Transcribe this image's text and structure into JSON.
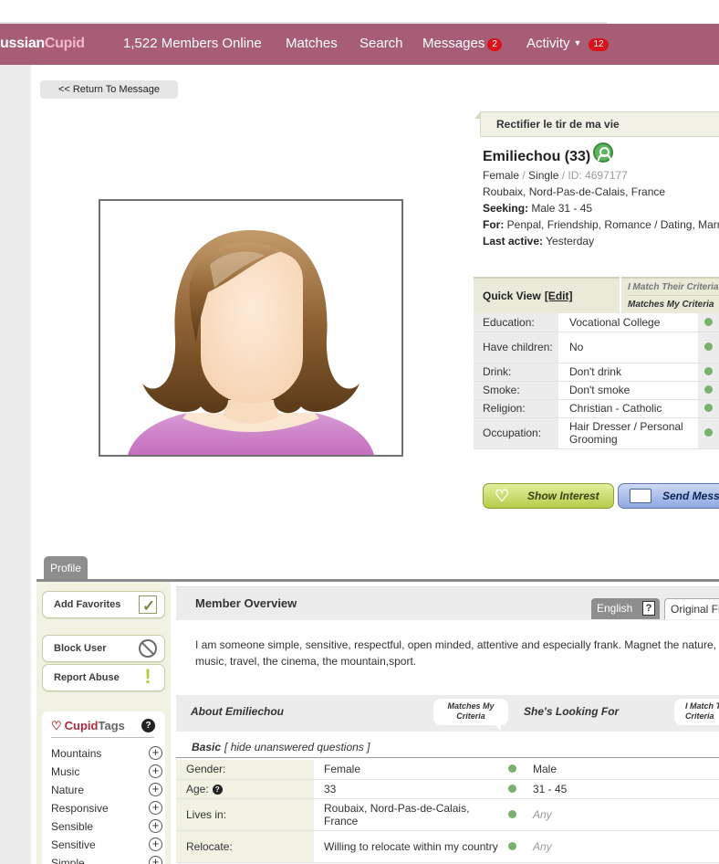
{
  "nav": {
    "logo_part1": "ussian",
    "logo_part2": "Cupid",
    "members_online": "1,522 Members Online",
    "matches": "Matches",
    "search": "Search",
    "messages": "Messages",
    "messages_count": "2",
    "activity": "Activity",
    "activity_count": "12"
  },
  "return_button": "<< Return To Message",
  "profile": {
    "headline": "Rectifier le tir de ma vie",
    "name_age": "Emiliechou (33)",
    "gender": "Female",
    "marital": "Single",
    "id_label": "ID: 4697177",
    "location": "Roubaix, Nord-Pas-de-Calais, France",
    "seeking_label": "Seeking:",
    "seeking": "Male 31 - 45",
    "for_label": "For:",
    "for": "Penpal, Friendship, Romance / Dating, Marriage",
    "last_active_label": "Last active:",
    "last_active": "Yesterday"
  },
  "quick_view": {
    "title": "Quick View",
    "edit": "[Edit]",
    "crit1": "I Match Their Criteria",
    "crit2": "Matches My Criteria",
    "rows": [
      {
        "label": "Education:",
        "value": "Vocational College"
      },
      {
        "label": "Have children:",
        "value": "No"
      },
      {
        "label": "Drink:",
        "value": "Don't drink"
      },
      {
        "label": "Smoke:",
        "value": "Don't smoke"
      },
      {
        "label": "Religion:",
        "value": "Christian - Catholic"
      },
      {
        "label": "Occupation:",
        "value": "Hair Dresser / Personal Grooming"
      }
    ]
  },
  "actions": {
    "show_interest": "Show Interest",
    "send_message": "Send Message"
  },
  "tabs": {
    "profile": "Profile"
  },
  "sidebar": {
    "add_favorites": "Add Favorites",
    "block_user": "Block User",
    "report_abuse": "Report Abuse",
    "cupidtags_1": "Cupid",
    "cupidtags_2": "Tags",
    "tags": [
      "Mountains",
      "Music",
      "Nature",
      "Responsive",
      "Sensible",
      "Sensitive",
      "Simple"
    ]
  },
  "overview": {
    "title": "Member Overview",
    "lang_english": "English",
    "lang_original": "Original French",
    "text_line1": "I am someone simple, sensitive, respectful, open minded, attentive and especially frank. Magnet the nature,",
    "text_line2": "music, travel, the cinema, the mountain,sport."
  },
  "about": {
    "left": "About Emiliechou",
    "right": "She's Looking For",
    "bubble_left": "Matches My Criteria",
    "bubble_right": "I Match Their Criteria",
    "basic": "Basic",
    "hide_link": "[ hide unanswered questions ]",
    "rows": [
      {
        "label": "Gender:",
        "value": "Female",
        "seek": "Male",
        "any": false
      },
      {
        "label": "Age:",
        "value": "33",
        "seek": "31 - 45",
        "any": false
      },
      {
        "label": "Lives in:",
        "value": "Roubaix, Nord-Pas-de-Calais, France",
        "seek": "Any",
        "any": true
      },
      {
        "label": "Relocate:",
        "value": "Willing to relocate within my country",
        "seek": "Any",
        "any": true
      }
    ]
  },
  "colors": {
    "nav": "#a85d77",
    "accent_green": "#7ab16c",
    "sidebar_bg": "#f1f2e1"
  }
}
